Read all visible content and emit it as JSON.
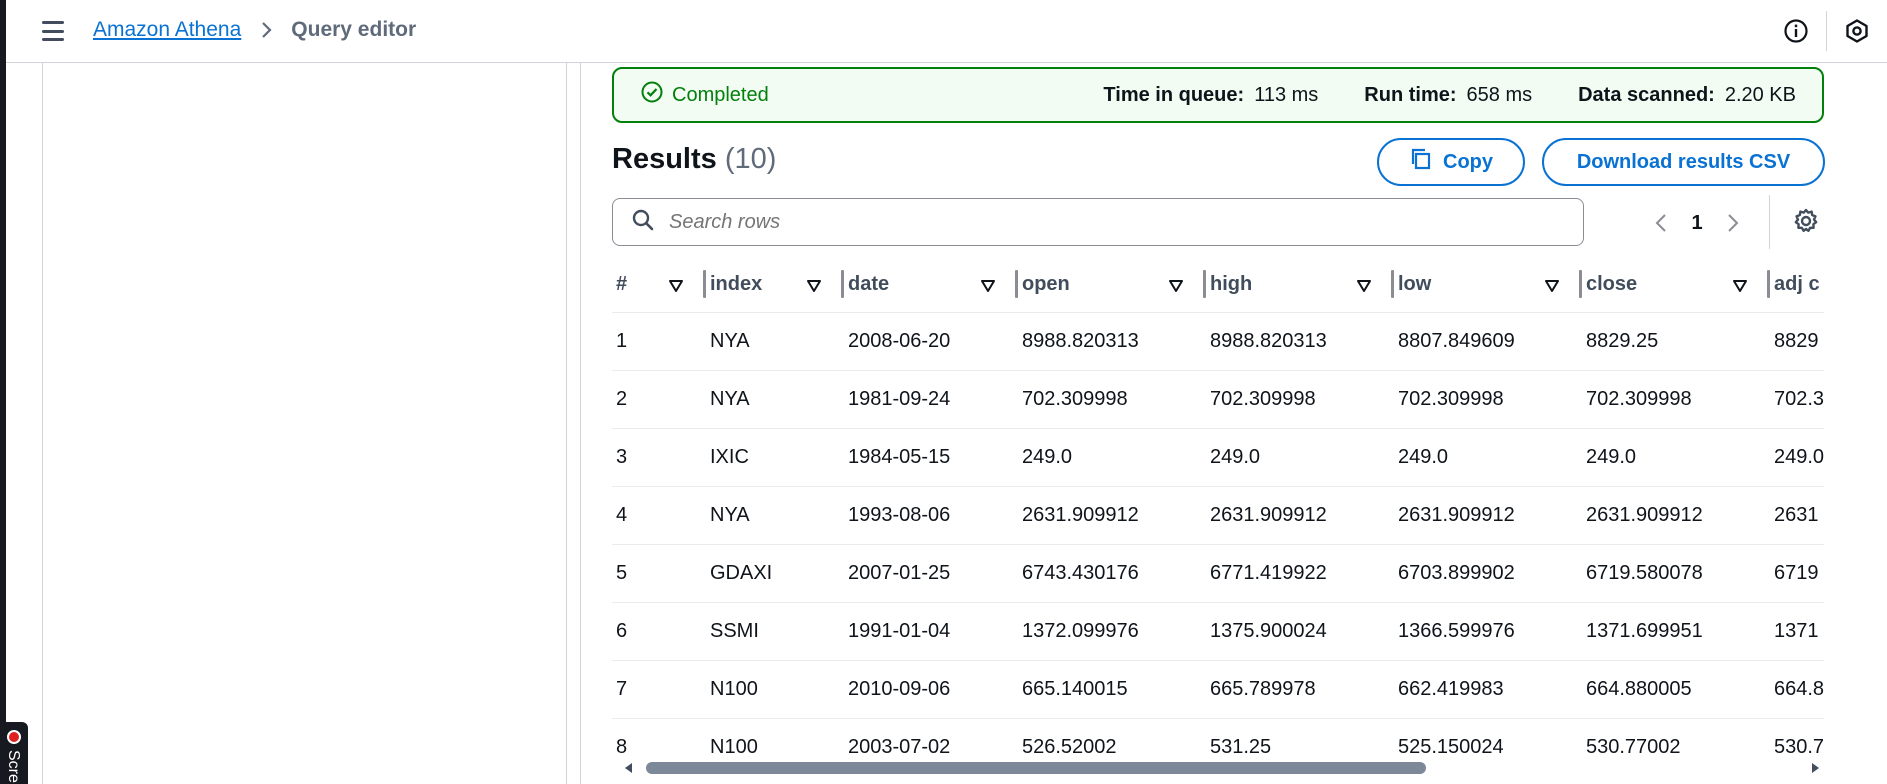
{
  "nav": {
    "breadcrumb_root": "Amazon Athena",
    "breadcrumb_current": "Query editor",
    "icons": [
      "menu-icon",
      "info-icon",
      "settings-hex-icon"
    ]
  },
  "status": {
    "label": "Completed",
    "time_in_queue_label": "Time in queue:",
    "time_in_queue": "113 ms",
    "run_time_label": "Run time:",
    "run_time": "658 ms",
    "data_scanned_label": "Data scanned:",
    "data_scanned": "2.20 KB",
    "color": "#037f0c"
  },
  "results": {
    "title": "Results",
    "count": "(10)",
    "copy_label": "Copy",
    "download_label": "Download results CSV",
    "search_placeholder": "Search rows",
    "page": "1"
  },
  "table": {
    "columns": [
      "#",
      "index",
      "date",
      "open",
      "high",
      "low",
      "close",
      "adj c"
    ],
    "rows": [
      [
        "1",
        "NYA",
        "2008-06-20",
        "8988.820313",
        "8988.820313",
        "8807.849609",
        "8829.25",
        "8829"
      ],
      [
        "2",
        "NYA",
        "1981-09-24",
        "702.309998",
        "702.309998",
        "702.309998",
        "702.309998",
        "702.3"
      ],
      [
        "3",
        "IXIC",
        "1984-05-15",
        "249.0",
        "249.0",
        "249.0",
        "249.0",
        "249.0"
      ],
      [
        "4",
        "NYA",
        "1993-08-06",
        "2631.909912",
        "2631.909912",
        "2631.909912",
        "2631.909912",
        "2631"
      ],
      [
        "5",
        "GDAXI",
        "2007-01-25",
        "6743.430176",
        "6771.419922",
        "6703.899902",
        "6719.580078",
        "6719"
      ],
      [
        "6",
        "SSMI",
        "1991-01-04",
        "1372.099976",
        "1375.900024",
        "1366.599976",
        "1371.699951",
        "1371"
      ],
      [
        "7",
        "N100",
        "2010-09-06",
        "665.140015",
        "665.789978",
        "662.419983",
        "664.880005",
        "664.8"
      ],
      [
        "8",
        "N100",
        "2003-07-02",
        "526.52002",
        "531.25",
        "525.150024",
        "530.77002",
        "530.7"
      ]
    ]
  },
  "recorder": {
    "label": "Scre"
  },
  "colors": {
    "link": "#0972d3",
    "success": "#037f0c",
    "text": "#0f141a"
  }
}
